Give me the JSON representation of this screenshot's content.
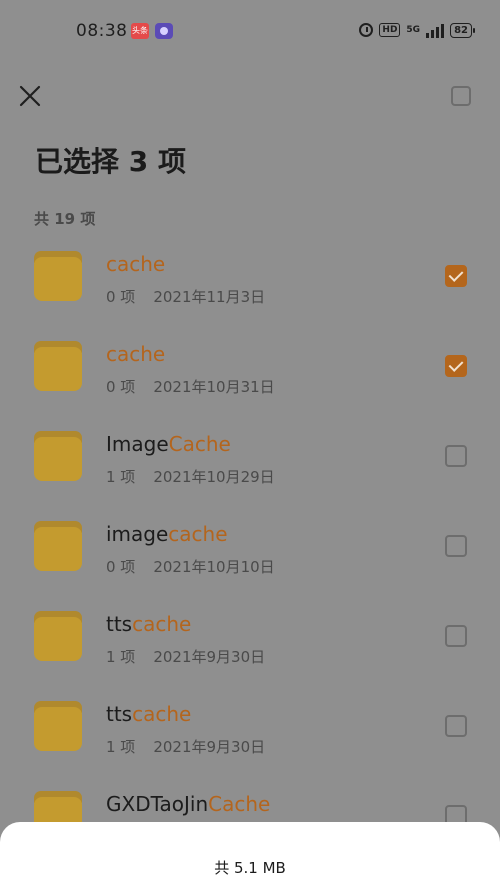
{
  "status_bar": {
    "time": "08:38",
    "app_badge_1": "头条",
    "network": "5G",
    "hd": "HD",
    "battery": "82"
  },
  "header": {
    "title": "已选择 3 项",
    "count_label": "共 19 项"
  },
  "items": [
    {
      "name_prefix": "",
      "name_highlight": "cache",
      "count": "0 项",
      "date": "2021年11月3日",
      "checked": true
    },
    {
      "name_prefix": "",
      "name_highlight": "cache",
      "count": "0 项",
      "date": "2021年10月31日",
      "checked": true
    },
    {
      "name_prefix": "Image",
      "name_highlight": "Cache",
      "count": "1 项",
      "date": "2021年10月29日",
      "checked": false
    },
    {
      "name_prefix": "image",
      "name_highlight": "cache",
      "count": "0 项",
      "date": "2021年10月10日",
      "checked": false
    },
    {
      "name_prefix": "tts",
      "name_highlight": "cache",
      "count": "1 项",
      "date": "2021年9月30日",
      "checked": false
    },
    {
      "name_prefix": "tts",
      "name_highlight": "cache",
      "count": "1 项",
      "date": "2021年9月30日",
      "checked": false
    },
    {
      "name_prefix": "GXDTaoJin",
      "name_highlight": "Cache",
      "count": "",
      "date": "",
      "checked": false
    }
  ],
  "footer": {
    "total_size": "共 5.1 MB"
  },
  "colors": {
    "highlight": "#b4651d",
    "folder": "#c49b2f",
    "overlay_background": "#8f8f8f"
  }
}
